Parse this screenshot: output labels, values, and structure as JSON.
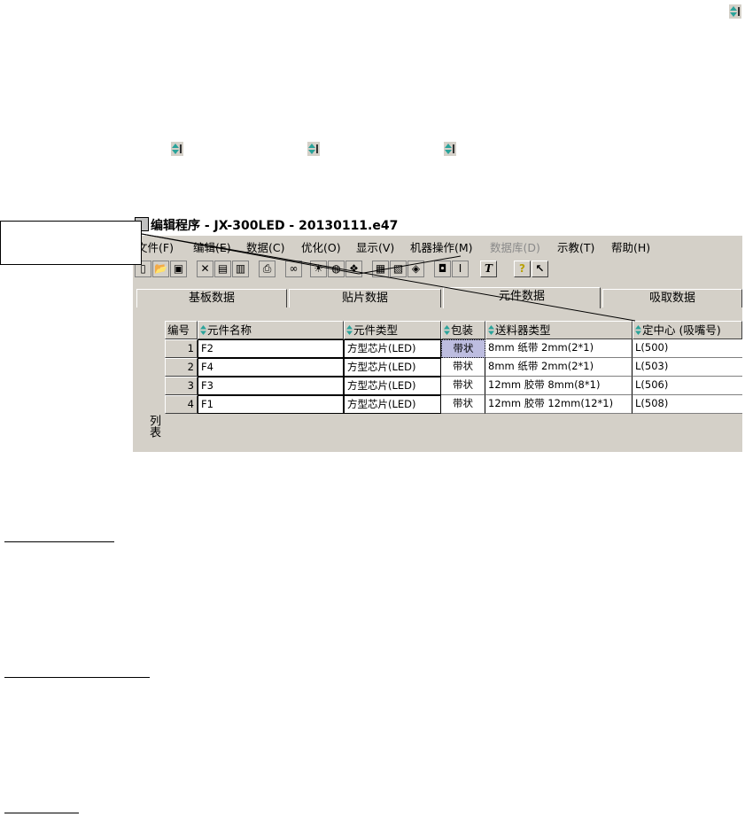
{
  "window": {
    "title": "编辑程序  - JX-300LED - 20130111.e47"
  },
  "menu": {
    "items": [
      {
        "label": "文件(F)",
        "disabled": false
      },
      {
        "label": "编辑(E)",
        "disabled": false
      },
      {
        "label": "数据(C)",
        "disabled": false
      },
      {
        "label": "优化(O)",
        "disabled": false
      },
      {
        "label": "显示(V)",
        "disabled": false
      },
      {
        "label": "机器操作(M)",
        "disabled": false
      },
      {
        "label": "数据库(D)",
        "disabled": true
      },
      {
        "label": "示教(T)",
        "disabled": false
      },
      {
        "label": "帮助(H)",
        "disabled": false
      }
    ]
  },
  "tabs": [
    {
      "label": "基板数据"
    },
    {
      "label": "贴片数据"
    },
    {
      "label": "元件数据"
    },
    {
      "label": "吸取数据"
    }
  ],
  "side_label": "列表",
  "table": {
    "columns": [
      "编号",
      "元件名称",
      "元件类型",
      "包装",
      "送料器类型",
      "定中心 (吸嘴号)"
    ],
    "rows": [
      {
        "num": "1",
        "name": "F2",
        "type": "方型芯片(LED)",
        "pack": "带状",
        "feeder": "8mm  纸带   2mm(2*1)",
        "center": "L(500)"
      },
      {
        "num": "2",
        "name": "F4",
        "type": "方型芯片(LED)",
        "pack": "带状",
        "feeder": "8mm  纸带   2mm(2*1)",
        "center": "L(503)"
      },
      {
        "num": "3",
        "name": "F3",
        "type": "方型芯片(LED)",
        "pack": "带状",
        "feeder": "12mm  胶带   8mm(8*1)",
        "center": "L(506)"
      },
      {
        "num": "4",
        "name": "F1",
        "type": "方型芯片(LED)",
        "pack": "带状",
        "feeder": "12mm  胶带   12mm(12*1)",
        "center": "L(508)"
      }
    ]
  },
  "toolbar": {
    "icons": [
      "new-icon",
      "open-icon",
      "save-icon",
      "cut-icon",
      "copy-icon",
      "paste-icon",
      "print-icon",
      "find-icon",
      "light-icon",
      "color-icon",
      "palette-icon",
      "component-icon",
      "feeder-icon",
      "package-icon",
      "nozzle-icon",
      "column-icon",
      "text-icon",
      "help-icon",
      "context-help-icon"
    ]
  },
  "colors": {
    "face": "#d4d0c8",
    "selection": "#bdbde0",
    "sort_arrow": "#2aa39a"
  }
}
